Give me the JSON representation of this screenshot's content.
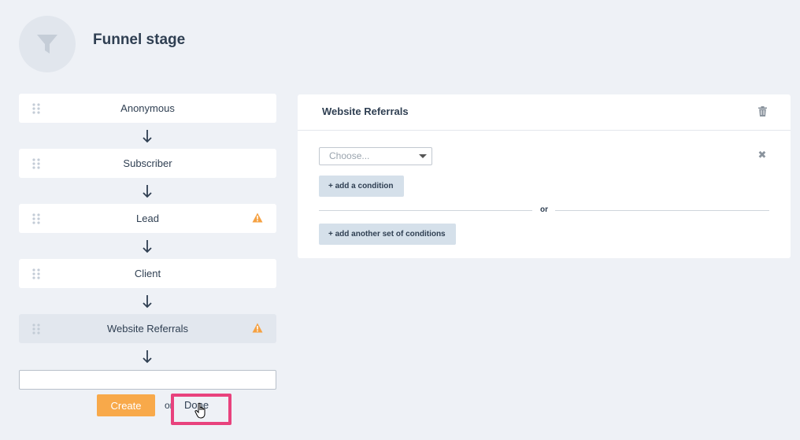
{
  "header": {
    "title": "Funnel stage",
    "icon": "funnel-icon"
  },
  "stages": [
    {
      "label": "Anonymous",
      "warning": false,
      "selected": false
    },
    {
      "label": "Subscriber",
      "warning": false,
      "selected": false
    },
    {
      "label": "Lead",
      "warning": true,
      "selected": false
    },
    {
      "label": "Client",
      "warning": false,
      "selected": false
    },
    {
      "label": "Website Referrals",
      "warning": true,
      "selected": true
    }
  ],
  "new_stage": {
    "value": "",
    "create_label": "Create",
    "or_label": "or",
    "done_label": "Done"
  },
  "panel": {
    "title": "Website Referrals",
    "select_placeholder": "Choose...",
    "add_condition_label": "+ add a condition",
    "or_label": "or",
    "add_set_label": "+ add another set of conditions"
  },
  "colors": {
    "accent": "#f8a94a",
    "warning": "#f5a142",
    "highlight": "#e8427d",
    "background": "#eef1f6"
  }
}
